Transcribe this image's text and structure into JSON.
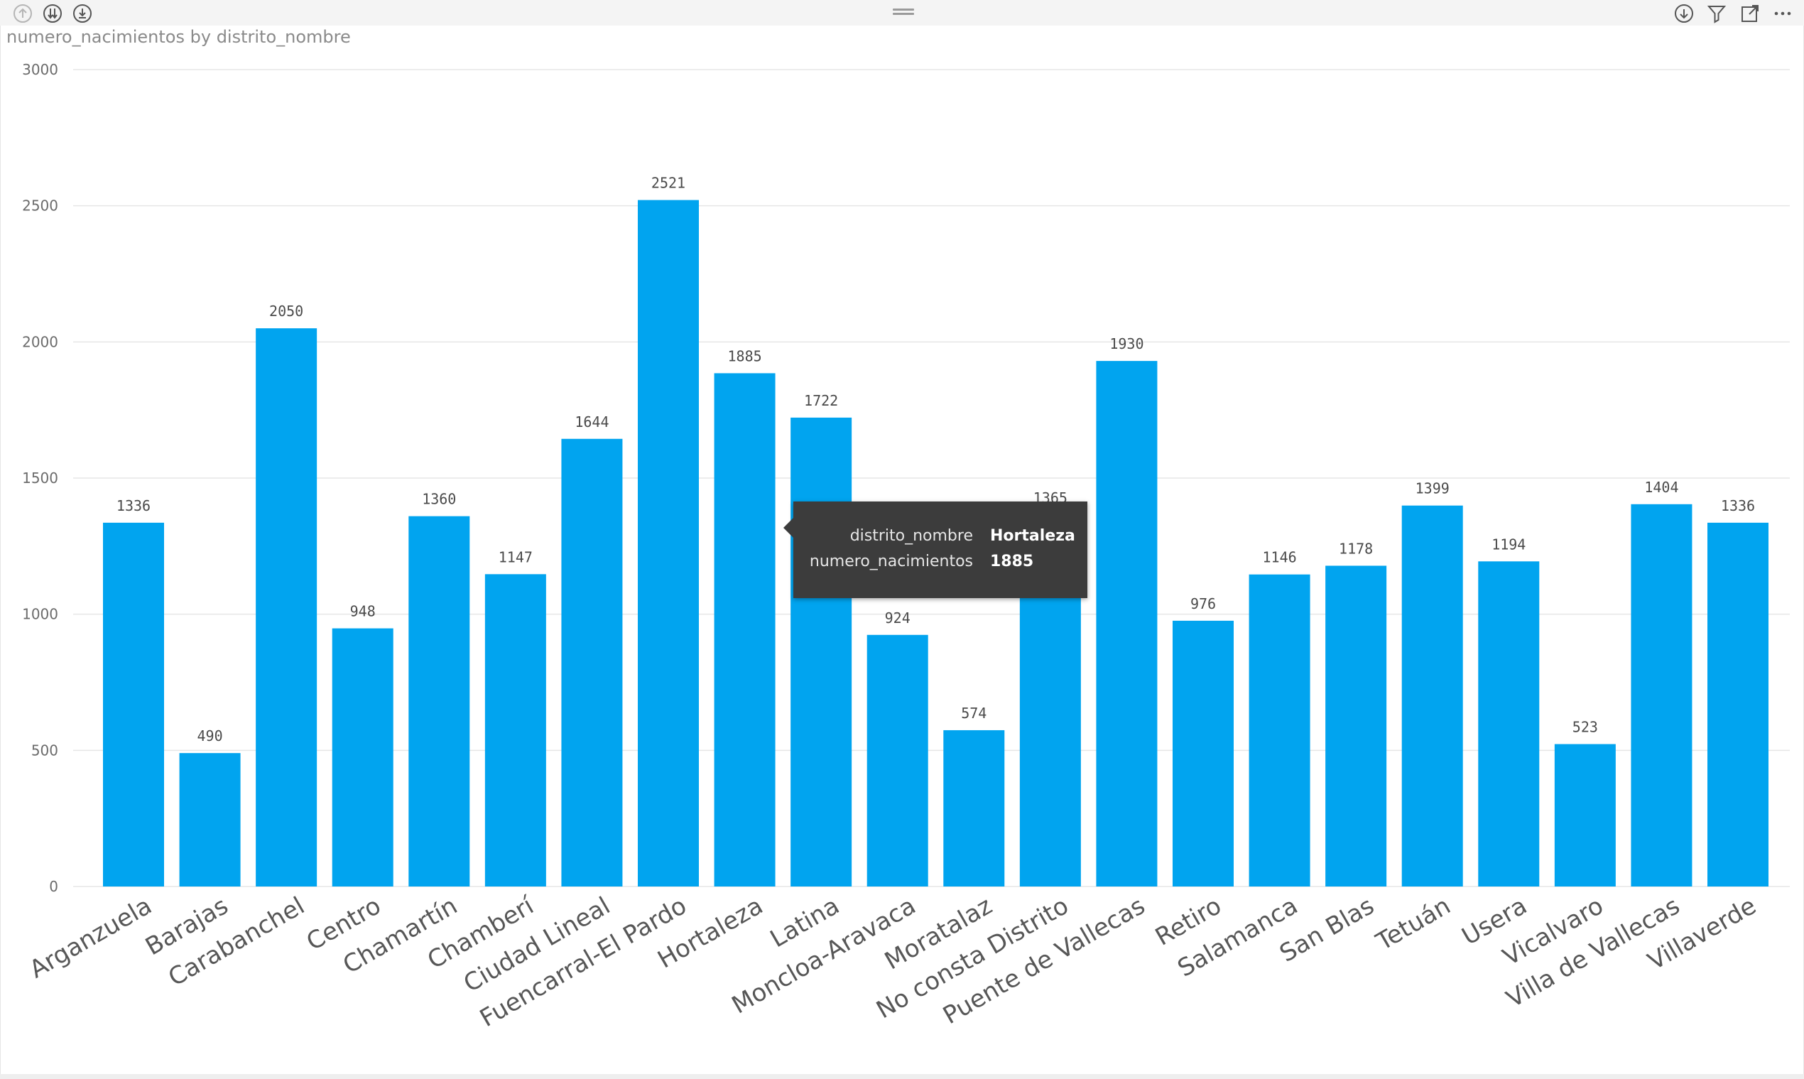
{
  "visual": {
    "title": "numero_nacimientos by distrito_nombre",
    "header_icons_left": [
      "drill-up-icon",
      "expand-all-down-icon",
      "drill-mode-icon"
    ],
    "header_icons_right": [
      "drill-down-icon",
      "filter-icon",
      "focus-mode-icon",
      "more-options-icon"
    ]
  },
  "tooltip": {
    "rows": [
      {
        "key": "distrito_nombre",
        "value": "Hortaleza"
      },
      {
        "key": "numero_nacimientos",
        "value": "1885"
      }
    ]
  },
  "chart_data": {
    "type": "bar",
    "title": "numero_nacimientos by distrito_nombre",
    "xlabel": "",
    "ylabel": "",
    "ylim": [
      0,
      3000
    ],
    "yticks": [
      0,
      500,
      1000,
      1500,
      2000,
      2500,
      3000
    ],
    "grid": true,
    "bar_color": "#01A4EF",
    "categories": [
      "Arganzuela",
      "Barajas",
      "Carabanchel",
      "Centro",
      "Chamartín",
      "Chamberí",
      "Ciudad Lineal",
      "Fuencarral-El Pardo",
      "Hortaleza",
      "Latina",
      "Moncloa-Aravaca",
      "Moratalaz",
      "No consta Distrito",
      "Puente de Vallecas",
      "Retiro",
      "Salamanca",
      "San Blas",
      "Tetuán",
      "Usera",
      "Vicalvaro",
      "Villa de Vallecas",
      "Villaverde"
    ],
    "values": [
      1336,
      490,
      2050,
      948,
      1360,
      1147,
      1644,
      2521,
      1885,
      1722,
      924,
      574,
      1365,
      1930,
      976,
      1146,
      1178,
      1399,
      1194,
      523,
      1404,
      1336
    ]
  }
}
